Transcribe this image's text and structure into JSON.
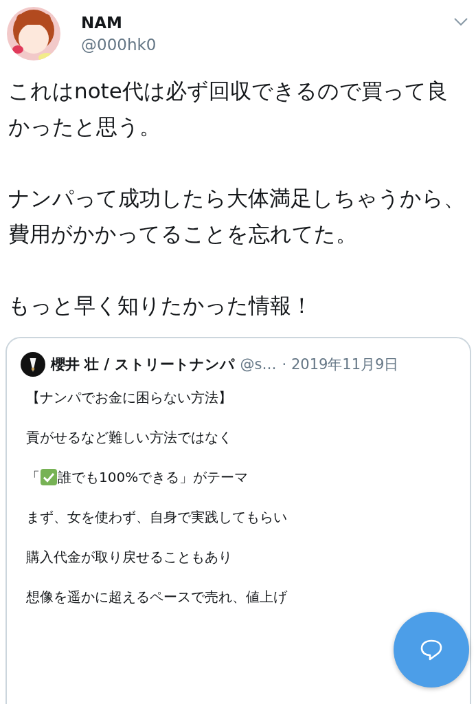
{
  "tweet": {
    "name": "NAM",
    "handle": "@000hk0",
    "paragraphs": [
      "これはnote代は必ず回収できるので買って良かったと思う。",
      "ナンパって成功したら大体満足しちゃうから、費用がかかってることを忘れてた。",
      "もっと早く知りたかった情報！"
    ]
  },
  "quoted_tweet": {
    "name": "櫻井 壮 / ストリートナンパ",
    "handle": "@s…",
    "date": "· 2019年11月9日",
    "lines": [
      {
        "kind": "text",
        "text": "【ナンパでお金に困らない方法】"
      },
      {
        "kind": "text",
        "text": "貢がせるなど難しい方法ではなく"
      },
      {
        "kind": "check",
        "before": "「",
        "after": "誰でも100%できる」がテーマ"
      },
      {
        "kind": "text",
        "text": "まず、女を使わず、自身で実践してもらい"
      },
      {
        "kind": "text",
        "text": "購入代金が取り戻せることもあり"
      },
      {
        "kind": "text",
        "text": "想像を遥かに超えるペースで売れ、値上げ"
      }
    ]
  }
}
